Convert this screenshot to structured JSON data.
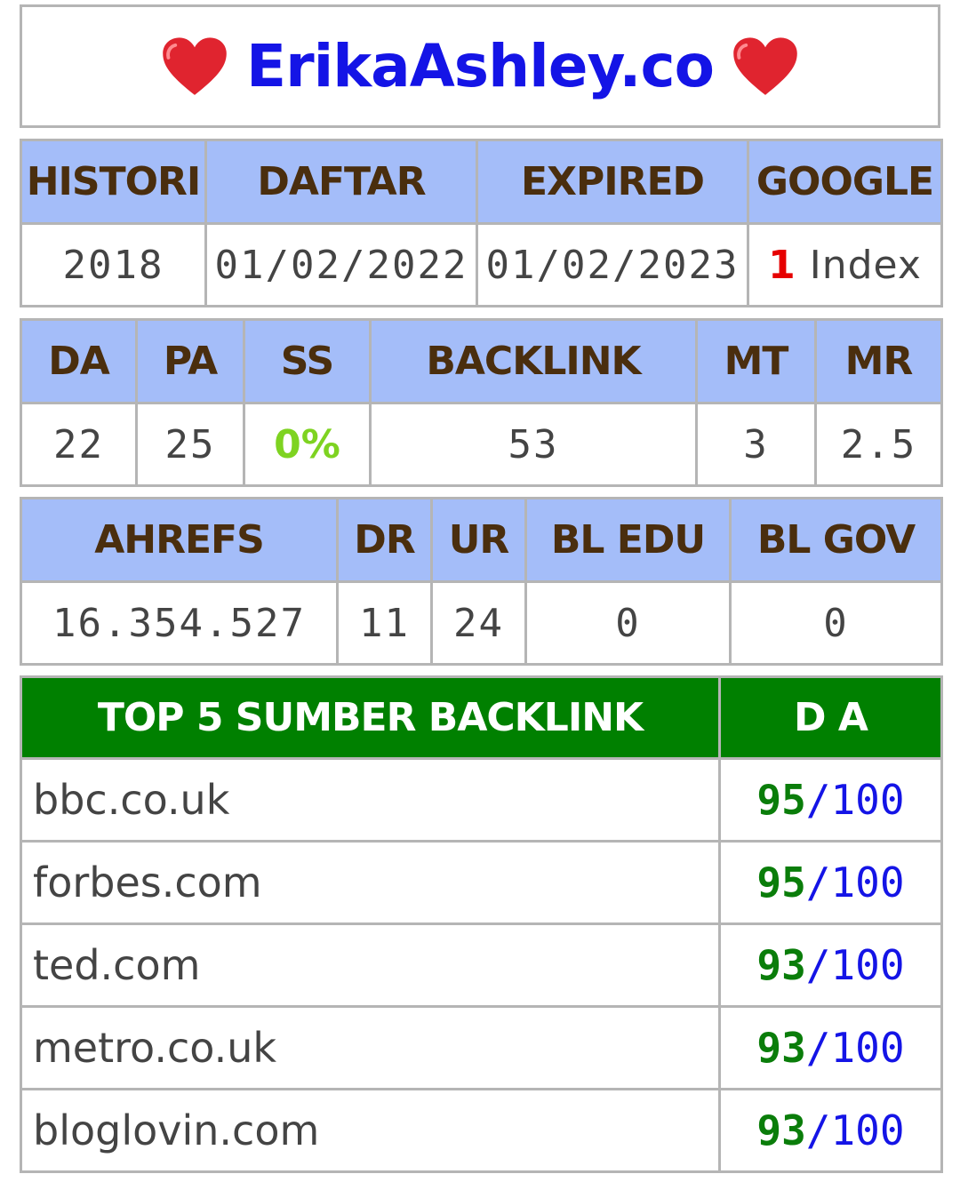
{
  "title": {
    "text": "ErikaAshley.co",
    "left_icon": "heart-icon",
    "right_icon": "heart-icon"
  },
  "table1": {
    "headers": [
      "HISTORI",
      "DAFTAR",
      "EXPIRED",
      "GOOGLE"
    ],
    "values": {
      "histori": "2018",
      "daftar": "01/02/2022",
      "expired": "01/02/2023",
      "google_count": "1",
      "google_label": " Index"
    }
  },
  "table2": {
    "headers": [
      "DA",
      "PA",
      "SS",
      "BACKLINK",
      "MT",
      "MR"
    ],
    "values": [
      "22",
      "25",
      "0%",
      "53",
      "3",
      "2.5"
    ]
  },
  "table3": {
    "headers": [
      "AHREFS",
      "DR",
      "UR",
      "BL EDU",
      "BL GOV"
    ],
    "values": [
      "16.354.527",
      "11",
      "24",
      "0",
      "0"
    ]
  },
  "backlinks": {
    "header_source": "TOP 5 SUMBER BACKLINK",
    "header_da": "D A",
    "rows": [
      {
        "site": "bbc.co.uk",
        "da": "95",
        "max": "/100"
      },
      {
        "site": "forbes.com",
        "da": "95",
        "max": "/100"
      },
      {
        "site": "ted.com",
        "da": "93",
        "max": "/100"
      },
      {
        "site": "metro.co.uk",
        "da": "93",
        "max": "/100"
      },
      {
        "site": "bloglovin.com",
        "da": "93",
        "max": "/100"
      }
    ]
  },
  "colors": {
    "header_bg": "#a4bdf9",
    "header_text": "#4a2e0e",
    "title": "#1414e6",
    "green": "#008000",
    "ss": "#7ed321",
    "red": "#e60000"
  }
}
